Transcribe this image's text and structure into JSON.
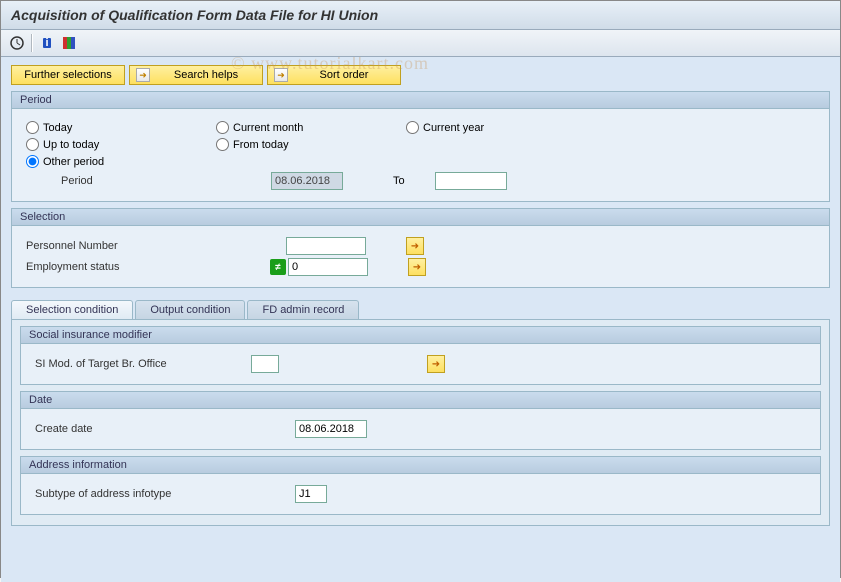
{
  "title": "Acquisition of Qualification Form Data File for HI Union",
  "watermark": "© www.tutorialkart.com",
  "actions": {
    "further": "Further selections",
    "search": "Search helps",
    "sort": "Sort order"
  },
  "period": {
    "label": "Period",
    "today": "Today",
    "current_month": "Current month",
    "current_year": "Current year",
    "up_to_today": "Up to today",
    "from_today": "From today",
    "other_period": "Other period",
    "period_label": "Period",
    "period_value": "08.06.2018",
    "to_label": "To",
    "to_value": ""
  },
  "selection": {
    "label": "Selection",
    "pernr_label": "Personnel Number",
    "pernr_value": "",
    "empstat_label": "Employment status",
    "empstat_value": "0"
  },
  "tabs": {
    "sel": "Selection condition",
    "out": "Output condition",
    "fd": "FD admin record"
  },
  "si": {
    "group": "Social insurance modifier",
    "label": "SI Mod. of Target Br. Office",
    "value": ""
  },
  "date": {
    "group": "Date",
    "label": "Create date",
    "value": "08.06.2018"
  },
  "address": {
    "group": "Address information",
    "label": "Subtype of address infotype",
    "value": "J1"
  }
}
